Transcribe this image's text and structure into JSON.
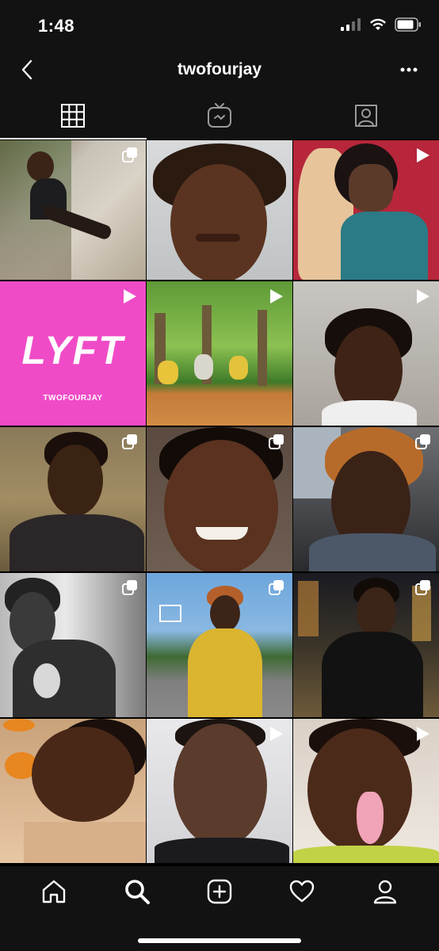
{
  "status_bar": {
    "time": "1:48"
  },
  "header": {
    "username": "twofourjay"
  },
  "tabs": [
    {
      "name": "grid",
      "icon": "grid-icon",
      "active": true
    },
    {
      "name": "igtv",
      "icon": "igtv-icon",
      "active": false
    },
    {
      "name": "tagged",
      "icon": "tagged-person-icon",
      "active": false
    }
  ],
  "posts": [
    {
      "type": "carousel"
    },
    {
      "type": "photo"
    },
    {
      "type": "video"
    },
    {
      "type": "video",
      "caption": "LYFT",
      "subcaption": "TWOFOURJAY"
    },
    {
      "type": "video"
    },
    {
      "type": "video"
    },
    {
      "type": "carousel"
    },
    {
      "type": "carousel"
    },
    {
      "type": "carousel"
    },
    {
      "type": "carousel"
    },
    {
      "type": "carousel"
    },
    {
      "type": "carousel"
    },
    {
      "type": "photo"
    },
    {
      "type": "video"
    },
    {
      "type": "video"
    }
  ],
  "bottom_nav": [
    {
      "name": "home",
      "icon": "home-icon"
    },
    {
      "name": "search",
      "icon": "search-icon",
      "active": true
    },
    {
      "name": "create",
      "icon": "add-post-icon"
    },
    {
      "name": "activity",
      "icon": "heart-icon"
    },
    {
      "name": "profile",
      "icon": "profile-icon"
    }
  ],
  "colors": {
    "background": "#121212",
    "lyft_pink": "#f04bc7",
    "icon": "#ffffff"
  }
}
